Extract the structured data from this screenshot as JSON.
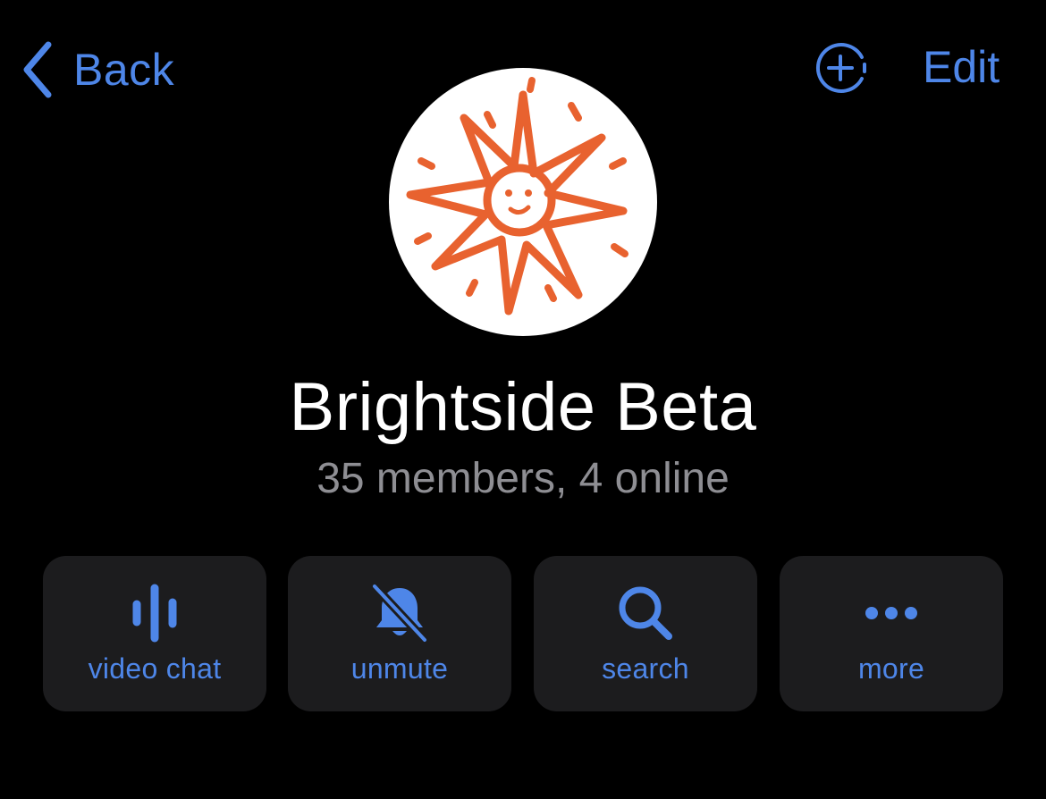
{
  "nav": {
    "back_label": "Back",
    "edit_label": "Edit",
    "add_icon": "add-member-icon"
  },
  "group": {
    "name": "Brightside Beta",
    "status": "35 members, 4 online",
    "avatar_icon": "smiling-sun-icon"
  },
  "actions": [
    {
      "label": "video chat",
      "icon": "voice-waveform-icon"
    },
    {
      "label": "unmute",
      "icon": "bell-slash-icon"
    },
    {
      "label": "search",
      "icon": "search-icon"
    },
    {
      "label": "more",
      "icon": "ellipsis-icon"
    }
  ],
  "colors": {
    "background": "#000000",
    "accent": "#4e86e8",
    "card": "#1c1c1e",
    "secondary_text": "#8e8e93",
    "avatar_sun": "#e8622f"
  }
}
